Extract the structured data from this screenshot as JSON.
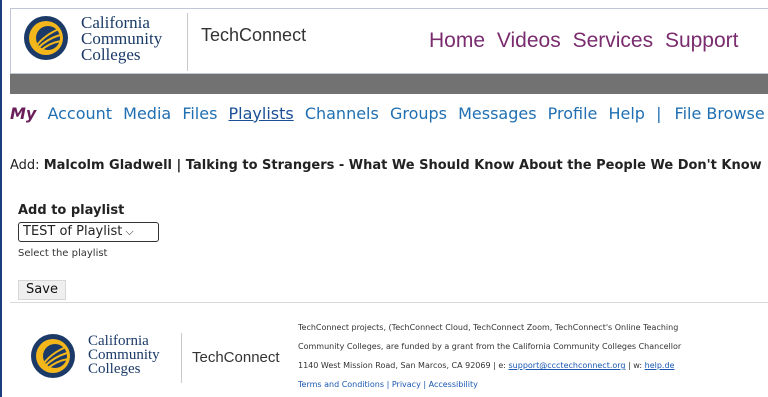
{
  "header": {
    "logo_lines": [
      "California",
      "Community",
      "Colleges"
    ],
    "brand": "TechConnect",
    "nav": [
      "Home",
      "Videos",
      "Services",
      "Support"
    ]
  },
  "mynav": {
    "my": "My",
    "items": [
      "Account",
      "Media",
      "Files",
      "Playlists",
      "Channels",
      "Groups",
      "Messages",
      "Profile",
      "Help"
    ],
    "active": "Playlists",
    "separator": "|",
    "trailing": "File Browse"
  },
  "content": {
    "add_prefix": "Add:",
    "add_title": "Malcolm Gladwell | Talking to Strangers - What We Should Know About the People We Don't Know",
    "playlist_label": "Add to playlist",
    "playlist_selected": "TEST of Playlist",
    "hint": "Select the playlist",
    "save": "Save"
  },
  "footer": {
    "logo_lines": [
      "California",
      "Community",
      "Colleges"
    ],
    "brand": "TechConnect",
    "line1": "TechConnect projects, (TechConnect Cloud, TechConnect Zoom, TechConnect's Online Teaching",
    "line2": "Community Colleges, are funded by a grant from the California Community Colleges Chancellor",
    "line3_prefix": "1140 West Mission Road, San Marcos, CA 92069 | e: ",
    "email": "support@ccctechconnect.org",
    "line3_mid": " | w: ",
    "web": "help.de",
    "terms": "Terms and Conditions",
    "privacy": "Privacy",
    "accessibility": "Accessibility",
    "sep": "|"
  },
  "colors": {
    "brand_navy": "#1c3a68",
    "nav_purple": "#7a2c6e",
    "link_blue": "#1f6fb2",
    "band_grey": "#727272"
  }
}
